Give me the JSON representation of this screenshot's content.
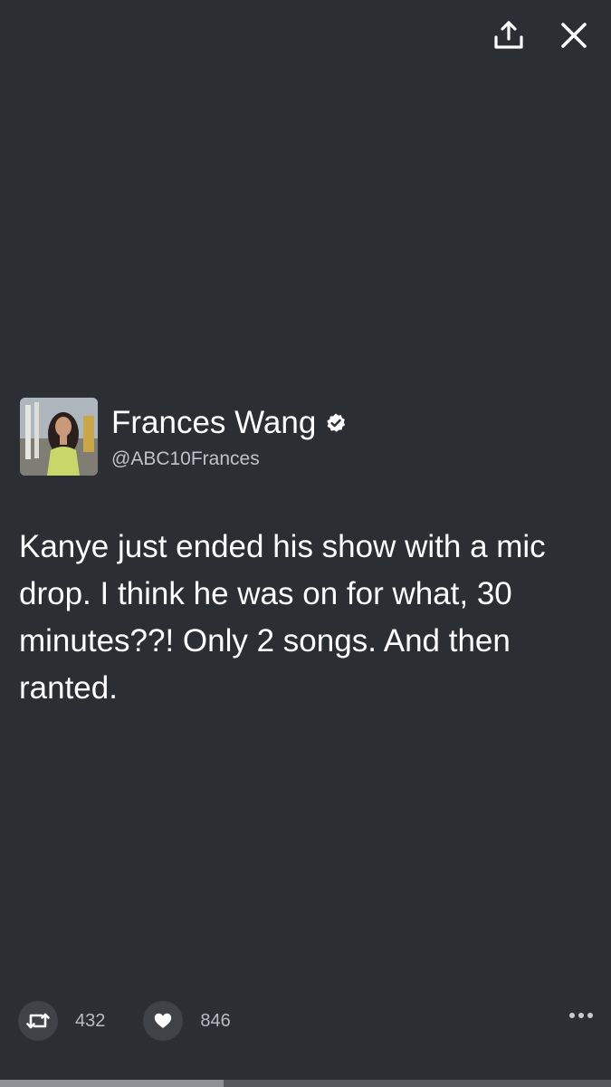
{
  "header": {
    "share_icon": "share-upload-icon",
    "close_icon": "close-icon"
  },
  "tweet": {
    "author": {
      "display_name": "Frances Wang",
      "handle": "@ABC10Frances",
      "verified": true
    },
    "text": "Kanye just ended his show with a mic drop. I think he was on for what, 30 minutes??! Only 2 songs. And then ranted."
  },
  "actions": {
    "retweet_count": "432",
    "like_count": "846",
    "more_icon": "more-dots-icon"
  },
  "progress": {
    "fraction": 0.366
  },
  "colors": {
    "background": "#2b2e33",
    "action_circle": "#3f4348",
    "secondary_text": "#bfc3c8"
  }
}
